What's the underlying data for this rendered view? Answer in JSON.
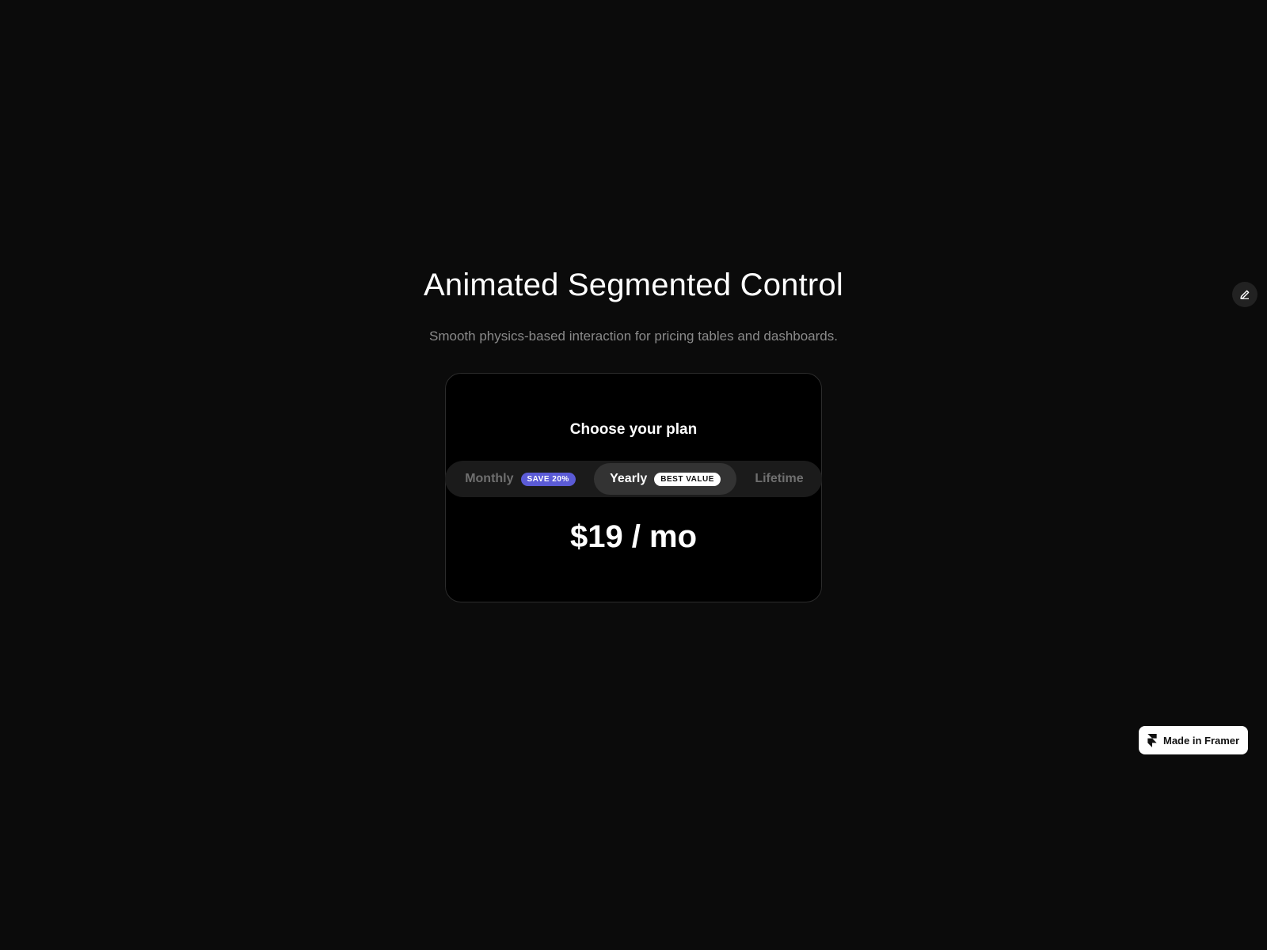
{
  "header": {
    "title": "Animated Segmented Control",
    "subtitle": "Smooth physics-based interaction for pricing tables and dashboards."
  },
  "card": {
    "title": "Choose your plan",
    "segments": [
      {
        "label": "Monthly",
        "badge": "SAVE 20%",
        "selected": false
      },
      {
        "label": "Yearly",
        "badge": "BEST VALUE",
        "selected": true
      },
      {
        "label": "Lifetime",
        "badge": "",
        "selected": false
      }
    ],
    "price": "$19 / mo"
  },
  "icons": {
    "edit": "pencil-icon",
    "framer": "framer-logo-icon"
  },
  "badge": {
    "label": "Made in Framer"
  },
  "colors": {
    "background": "#0b0b0b",
    "card": "#000000",
    "accent": "#5b5bd6",
    "selected_segment": "#333333"
  }
}
